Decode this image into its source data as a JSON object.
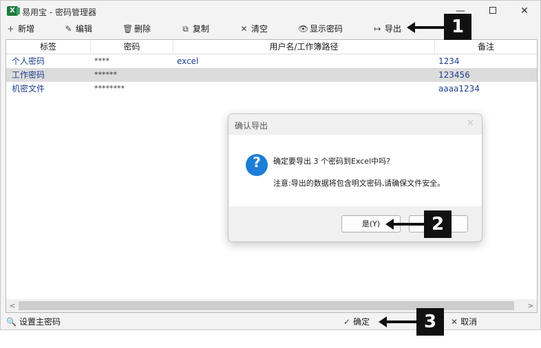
{
  "window": {
    "title": "易用宝 - 密码管理器",
    "app_icon_letter": "X",
    "min_glyph": "—",
    "close_glyph": "✕"
  },
  "toolbar": {
    "items": [
      {
        "label": "新增",
        "icon": "plus-icon",
        "glyph": "+"
      },
      {
        "label": "编辑",
        "icon": "pencil-icon",
        "glyph": "✎"
      },
      {
        "label": "删除",
        "icon": "trash-icon",
        "glyph": "🗑"
      },
      {
        "label": "复制",
        "icon": "copy-icon",
        "glyph": "⧉"
      },
      {
        "label": "清空",
        "icon": "clear-icon",
        "glyph": "✕"
      },
      {
        "label": "显示密码",
        "icon": "eye-icon",
        "glyph": "👁"
      },
      {
        "label": "导出",
        "icon": "export-icon",
        "glyph": "↦"
      }
    ]
  },
  "table": {
    "columns": [
      "标签",
      "密码",
      "用户名/工作簿路径",
      "备注"
    ],
    "rows": [
      {
        "tag": "个人密码",
        "password": "****",
        "user": "excel",
        "note": "1234",
        "selected": false
      },
      {
        "tag": "工作密码",
        "password": "******",
        "user": "",
        "note": "123456",
        "selected": true
      },
      {
        "tag": "机密文件",
        "password": "********",
        "user": "",
        "note": "aaaa1234",
        "selected": false
      }
    ],
    "scroll_left": "<",
    "scroll_right": ">"
  },
  "statusbar": {
    "set_master": "设置主密码",
    "ok": "确定",
    "cancel": "取消"
  },
  "dialog": {
    "title": "确认导出",
    "close_glyph": "✕",
    "icon_glyph": "?",
    "message": "确定要导出 3 个密码到Excel中吗?",
    "note": "注意:导出的数据将包含明文密码,请确保文件安全。",
    "yes_label": "是(Y)",
    "no_label": ""
  },
  "annotations": [
    "1",
    "2",
    "3"
  ],
  "colors": {
    "accent": "#1c7ed6",
    "text_blue": "#1f3f8f",
    "selection": "#dcdcdc",
    "callout": "#111111"
  }
}
